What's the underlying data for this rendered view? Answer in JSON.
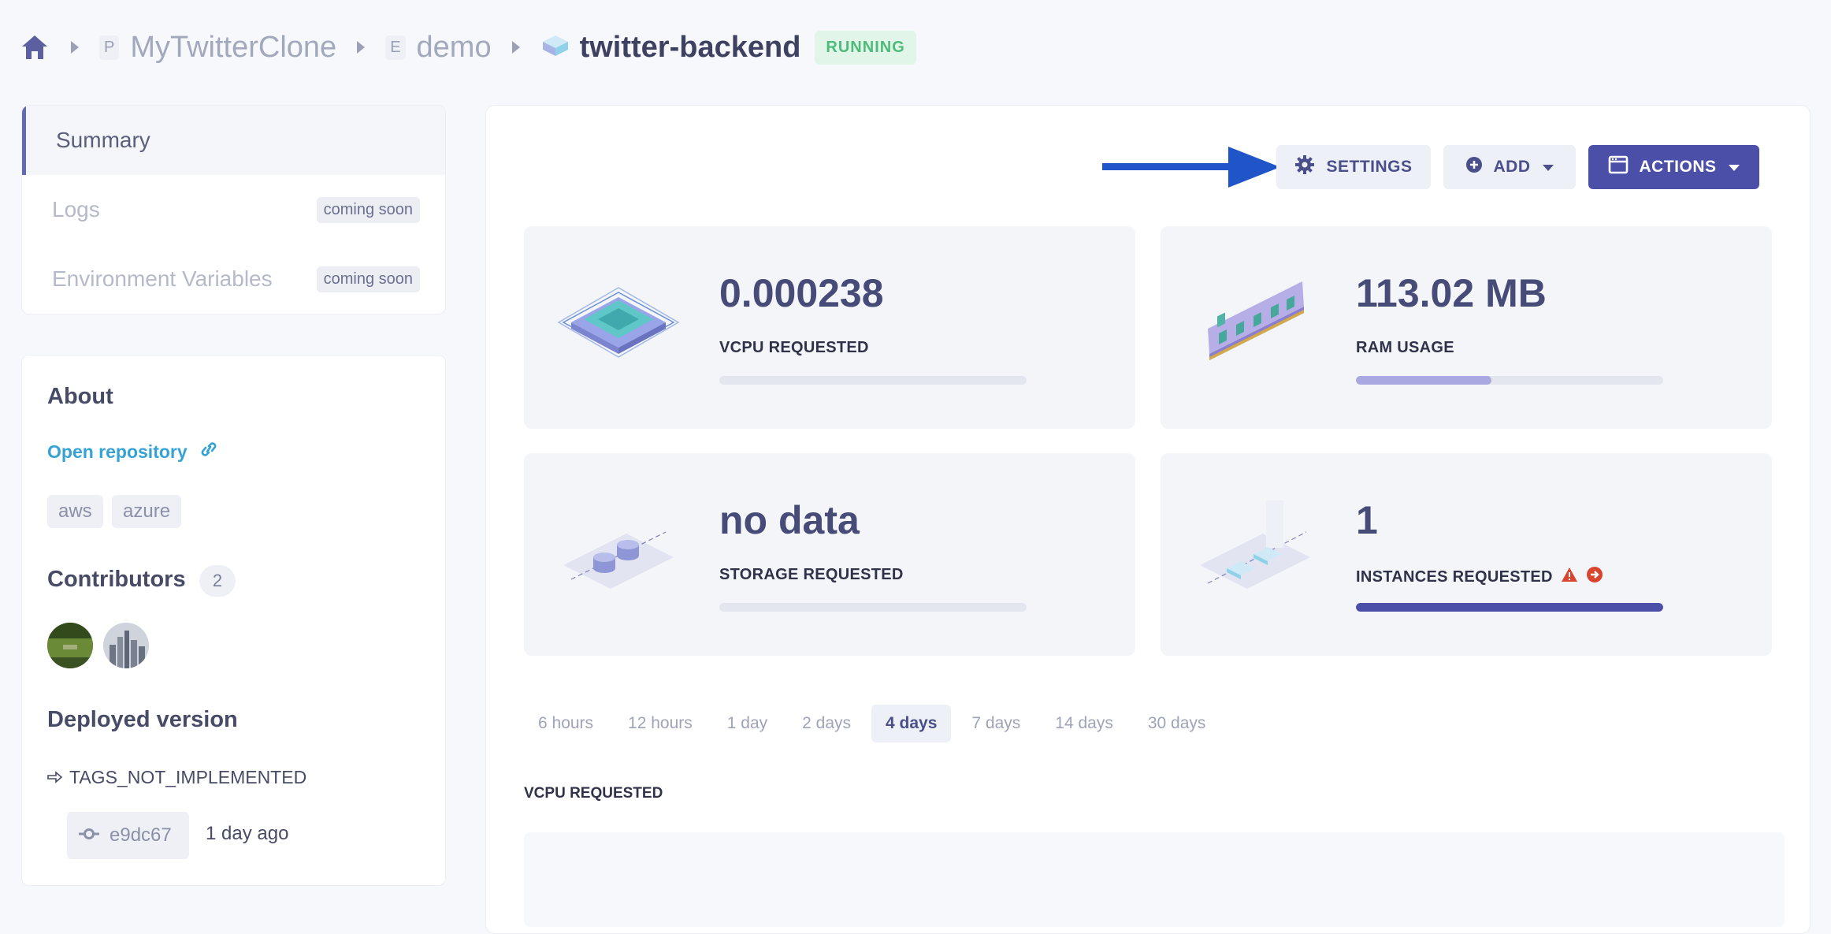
{
  "breadcrumb": {
    "project_badge": "P",
    "project": "MyTwitterClone",
    "env_badge": "E",
    "environment": "demo",
    "service": "twitter-backend",
    "status": "RUNNING"
  },
  "nav": {
    "items": [
      {
        "label": "Summary",
        "active": true
      },
      {
        "label": "Logs",
        "badge": "coming soon"
      },
      {
        "label": "Environment Variables",
        "badge": "coming soon"
      }
    ]
  },
  "about": {
    "title": "About",
    "repo_link": "Open repository",
    "tags": [
      "aws",
      "azure"
    ],
    "contributors_title": "Contributors",
    "contributors_count": "2",
    "deployed_title": "Deployed version",
    "tag_name": "TAGS_NOT_IMPLEMENTED",
    "commit": "e9dc67",
    "commit_time": "1 day ago"
  },
  "toolbar": {
    "settings": "SETTINGS",
    "add": "ADD",
    "actions": "ACTIONS"
  },
  "metrics": [
    {
      "value": "0.000238",
      "label": "VCPU REQUESTED",
      "fill": 0.0,
      "fill_color": "#a7a9da"
    },
    {
      "value": "113.02 MB",
      "label": "RAM USAGE",
      "fill": 0.44,
      "fill_color": "#a7a9e0"
    },
    {
      "value": "no data",
      "label": "STORAGE REQUESTED",
      "fill": 0.0,
      "fill_color": "#a7a9da"
    },
    {
      "value": "1",
      "label": "INSTANCES REQUESTED",
      "fill": 1.0,
      "fill_color": "#4c4fa8"
    }
  ],
  "range_tabs": [
    "6 hours",
    "12 hours",
    "1 day",
    "2 days",
    "4 days",
    "7 days",
    "14 days",
    "30 days"
  ],
  "active_range": "4 days",
  "chart_title": "VCPU REQUESTED",
  "colors": {
    "accent": "#4c4fa8",
    "running": "#4dbb7a",
    "link": "#35a2d4",
    "arrow": "#1f55c8",
    "warning": "#d9452f"
  }
}
